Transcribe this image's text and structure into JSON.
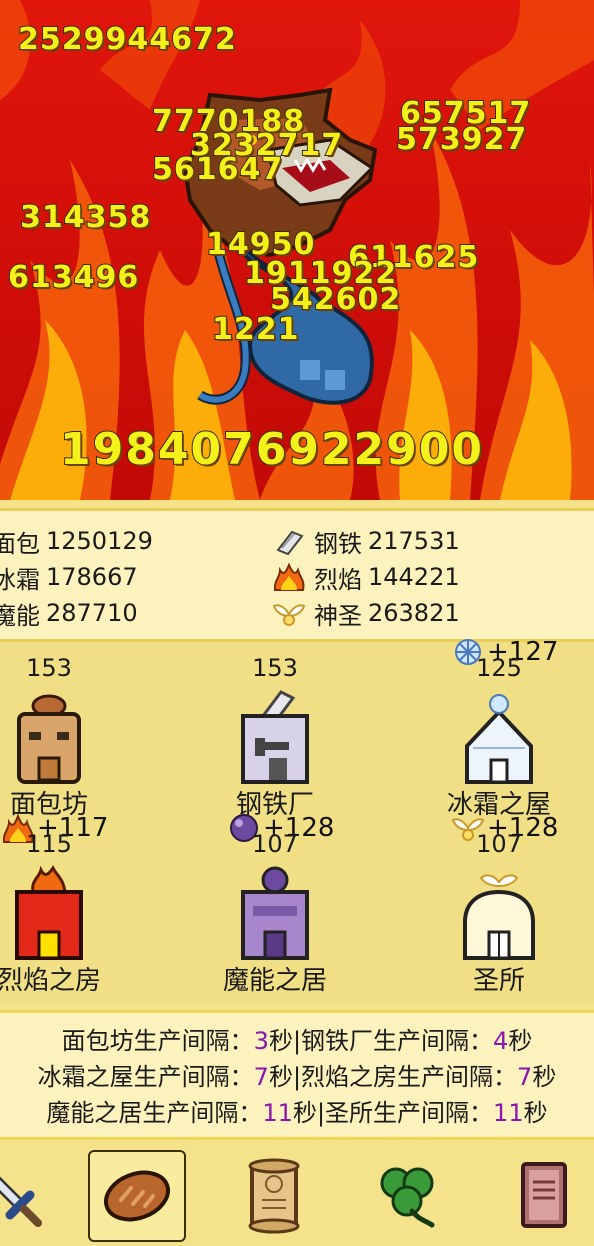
{
  "battle": {
    "total_damage": "2529944672",
    "big_damage": "1984076922900",
    "damage_numbers": [
      "7770188",
      "3232717",
      "561647",
      "657517",
      "573927",
      "314358",
      "613496",
      "14950",
      "611625",
      "1911922",
      "542602",
      "1221"
    ]
  },
  "resources": [
    {
      "name": "面包",
      "value": "1250129",
      "icon": "bread-icon"
    },
    {
      "name": "钢铁",
      "value": "217531",
      "icon": "steel-icon"
    },
    {
      "name": "冰霜",
      "value": "178667",
      "icon": "frost-icon"
    },
    {
      "name": "烈焰",
      "value": "144221",
      "icon": "flame-icon"
    },
    {
      "name": "魔能",
      "value": "287710",
      "icon": "magic-icon"
    },
    {
      "name": "神圣",
      "value": "263821",
      "icon": "holy-icon"
    }
  ],
  "buildings": [
    {
      "name": "面包坊",
      "count": "153",
      "bonus": ""
    },
    {
      "name": "钢铁厂",
      "count": "153",
      "bonus": ""
    },
    {
      "name": "冰霜之屋",
      "count": "125",
      "bonus": "+127"
    },
    {
      "name": "烈焰之房",
      "count": "115",
      "bonus": "+117"
    },
    {
      "name": "魔能之居",
      "count": "107",
      "bonus": "+128"
    },
    {
      "name": "圣所",
      "count": "107",
      "bonus": "+128"
    }
  ],
  "intervals": [
    {
      "label": "面包坊生产间隔：",
      "value": "3",
      "unit": "秒"
    },
    {
      "label": "|钢铁厂生产间隔：",
      "value": "4",
      "unit": "秒"
    },
    {
      "label": "冰霜之屋生产间隔：",
      "value": "7",
      "unit": "秒"
    },
    {
      "label": "|烈焰之房生产间隔：",
      "value": "7",
      "unit": "秒"
    },
    {
      "label": "魔能之居生产间隔：",
      "value": "11",
      "unit": "秒"
    },
    {
      "label": "|圣所生产间隔：",
      "value": "11",
      "unit": "秒"
    }
  ],
  "nav": {
    "active": "bread",
    "tabs": [
      "sword-icon",
      "bread-icon",
      "scroll-icon",
      "clover-icon",
      "book-icon"
    ]
  },
  "colors": {
    "fire_bg": "#d4100a",
    "damage_text": "#f4f01a",
    "panel": "#fbf2bd",
    "interval_number": "#8a16b0"
  }
}
